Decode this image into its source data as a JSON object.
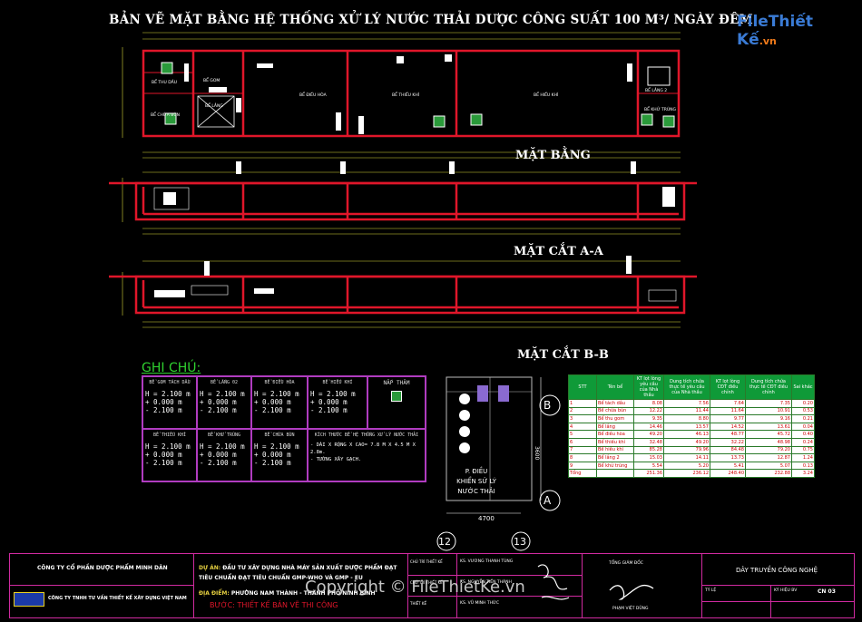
{
  "drawing": {
    "title": "BẢN VẼ MẶT BẰNG HỆ THỐNG XỬ LÝ NƯỚC THẢI DƯỢC CÔNG SUẤT 100 M³/ NGÀY ĐÊM",
    "logo_part1": "File",
    "logo_part2": "Thiết Kế",
    "logo_part3": ".vn",
    "sections": {
      "plan": "MẶT BẰNG",
      "section_aa": "MẶT CẮT A-A",
      "section_bb": "MẶT CẮT B-B"
    },
    "tank_labels": [
      "BỂ GOM",
      "BỂ THU DẦU",
      "BỂ LẮNG",
      "BỂ ĐIỀU HÒA",
      "BỂ THIẾU KHÍ",
      "BỂ HIẾU KHÍ",
      "BỂ LẮNG 2",
      "BỂ KHỬ TRÙNG",
      "BỂ CHỨA BÙN"
    ]
  },
  "notes": {
    "heading": "GHI CHÚ:",
    "cells": [
      {
        "name": "BỂ GOM TÁCH DẦU",
        "l1": "H = 2.100 m",
        "l2": "+ 0.000 m",
        "l3": "- 2.100 m"
      },
      {
        "name": "BỂ LẮNG 02",
        "l1": "H = 2.100 m",
        "l2": "+ 0.000 m",
        "l3": "- 2.100 m"
      },
      {
        "name": "BỂ ĐIỀU HÒA",
        "l1": "H = 2.100 m",
        "l2": "+ 0.000 m",
        "l3": "- 2.100 m"
      },
      {
        "name": "BỂ HIẾU KHÍ",
        "l1": "H = 2.100 m",
        "l2": "+ 0.000 m",
        "l3": "- 2.100 m"
      },
      {
        "name": "BỂ THIẾU KHÍ",
        "l1": "H = 2.100 m",
        "l2": "+ 0.000 m",
        "l3": "- 2.100 m"
      },
      {
        "name": "BỂ KHỬ TRÙNG",
        "l1": "H = 2.100 m",
        "l2": "+ 0.000 m",
        "l3": "- 2.100 m"
      },
      {
        "name": "BỂ CHỨA BÙN",
        "l1": "H = 2.100 m",
        "l2": "+ 0.000 m",
        "l3": "- 2.100 m"
      }
    ],
    "cover_label": "NẮP THĂM",
    "wall_note_title": "KÍCH THƯỚC BỂ HỆ THỐNG XỬ LÝ NƯỚC THẢI",
    "wall_note_1": "- DÀI X RỘNG X CAO= 7.8 M X 4.5 M X 2.8m.",
    "wall_note_2": "- TƯỜNG XÂY GẠCH."
  },
  "control_room": {
    "label": "P. ĐIỀU KHIỂN SỬ LÝ NƯỚC THẢI",
    "axis_b": "B",
    "axis_a": "A",
    "axis_12": "12",
    "axis_13": "13",
    "dim_width": "4700",
    "dim_height": "3600"
  },
  "table": {
    "headers": [
      "STT",
      "Tên bể",
      "KT lọt lòng yêu cầu của Nhà thầu",
      "Dung tích chứa thực tế yêu cầu của Nhà thầu",
      "KT lọt lòng CĐT điều chỉnh",
      "Dung tích chứa thực tế CĐT điều chỉnh",
      "Sai khác"
    ],
    "rows": [
      [
        "1",
        "Bể tách dầu",
        "8.08",
        "7.56",
        "7.64",
        "7.35",
        "0.20"
      ],
      [
        "2",
        "Bể chứa bùn",
        "12.22",
        "11.44",
        "11.64",
        "10.91",
        "0.53"
      ],
      [
        "3",
        "Bể thu gom",
        "9.35",
        "8.80",
        "9.77",
        "9.16",
        "0.21"
      ],
      [
        "4",
        "Bể lắng",
        "14.46",
        "13.57",
        "14.52",
        "13.61",
        "0.04"
      ],
      [
        "5",
        "Bể điều hòa",
        "49.20",
        "46.13",
        "48.77",
        "45.72",
        "0.40"
      ],
      [
        "6",
        "Bể thiếu khí",
        "32.48",
        "49.20",
        "32.22",
        "48.98",
        "0.24"
      ],
      [
        "7",
        "Bể hiếu khí",
        "85.28",
        "79.96",
        "84.48",
        "79.20",
        "0.75"
      ],
      [
        "8",
        "Bể lắng 2",
        "15.03",
        "14.11",
        "13.73",
        "12.87",
        "1.24"
      ],
      [
        "9",
        "Bể khử trùng",
        "5.54",
        "5.20",
        "5.41",
        "5.07",
        "0.13"
      ],
      [
        "Tổng",
        "",
        "251.36",
        "236.12",
        "248.40",
        "232.88",
        "3.24"
      ]
    ]
  },
  "title_block": {
    "company": "CÔNG TY CỔ PHẦN DƯỢC PHẨM MINH DÂN",
    "consultant": "CÔNG TY TNHH TƯ VẤN THIẾT KẾ XÂY DỰNG VIỆT NAM",
    "project_label": "DỰ ÁN:",
    "project": "ĐẦU TƯ XÂY DỰNG NHÀ MÁY SẢN XUẤT DƯỢC PHẨM ĐẠT TIÊU CHUẨN ĐẠT TIÊU CHUẨN GMP-WHO VÀ GMP - EU",
    "location_label": "ĐỊA ĐIỂM:",
    "location": "PHƯỜNG NAM THÀNH - THÀNH PHỐ NINH BÌNH",
    "phase": "BƯỚC: THIẾT KẾ BẢN VẼ THI CÔNG",
    "role_1": "CHỦ TRÌ THIẾT KẾ",
    "role_2": "CHỦ TRÌ THIẾT KẾ",
    "role_3": "THIẾT KẾ",
    "person_1": "KS. VƯƠNG THANH TÙNG",
    "person_2": "KS. NGUYỄN TIẾN THÀNH",
    "person_3": "KS. VŨ MINH THỨC",
    "director": "TỔNG GIÁM ĐỐC",
    "director_name": "PHẠM VIỆT DŨNG",
    "sheet_title": "DÂY TRUYỀN CÔNG NGHỆ",
    "scale_label": "TỶ LỆ",
    "code_label": "KÝ HIỆU BV",
    "sheet_code": "CN 03",
    "watermark": "Copyright © FileThietKe.vn"
  }
}
